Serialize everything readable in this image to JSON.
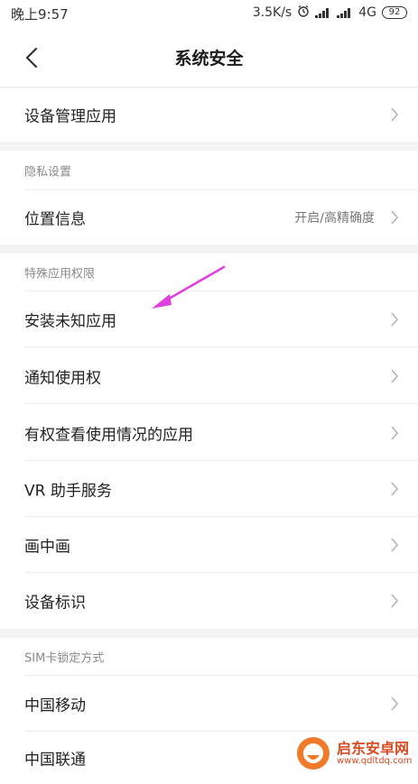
{
  "status_bar": {
    "time": "晚上9:57",
    "speed": "3.5K/s",
    "network": "4G",
    "battery": "92"
  },
  "header": {
    "title": "系统安全"
  },
  "sections": {
    "device_admin": {
      "label": "设备管理应用"
    },
    "privacy": {
      "header": "隐私设置",
      "location_label": "位置信息",
      "location_value": "开启/高精确度"
    },
    "special": {
      "header": "特殊应用权限",
      "items": [
        "安装未知应用",
        "通知使用权",
        "有权查看使用情况的应用",
        "VR 助手服务",
        "画中画",
        "设备标识"
      ]
    },
    "sim": {
      "header": "SIM卡锁定方式",
      "items": [
        "中国移动",
        "中国联通"
      ]
    }
  },
  "watermark": {
    "title": "启东安卓网",
    "url": "www.qdltdq.com"
  },
  "colors": {
    "annotation_arrow": "#e040e0",
    "divider": "#f3f3f3",
    "secondary_text": "#8a8a8a"
  }
}
